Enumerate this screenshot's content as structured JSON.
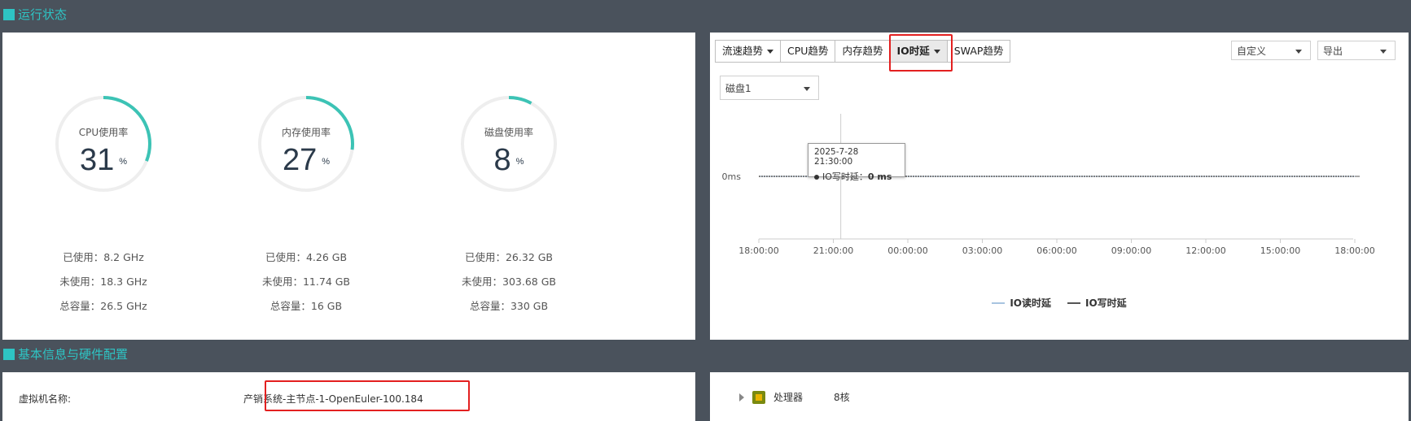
{
  "sections": {
    "status_title": "运行状态",
    "basic_title": "基本信息与硬件配置"
  },
  "gauges": [
    {
      "label": "CPU使用率",
      "value": "31",
      "unit": "%",
      "used": "已使用：8.2 GHz",
      "free": "未使用：18.3 GHz",
      "total": "总容量：26.5 GHz"
    },
    {
      "label": "内存使用率",
      "value": "27",
      "unit": "%",
      "used": "已使用：4.26 GB",
      "free": "未使用：11.74 GB",
      "total": "总容量：16 GB"
    },
    {
      "label": "磁盘使用率",
      "value": "8",
      "unit": "%",
      "used": "已使用：26.32 GB",
      "free": "未使用：303.68 GB",
      "total": "总容量：330 GB"
    }
  ],
  "tabs": {
    "flow": "流速趋势",
    "cpu": "CPU趋势",
    "mem": "内存趋势",
    "io": "IO时延",
    "swap": "SWAP趋势"
  },
  "controls": {
    "range": "自定义",
    "export": "导出",
    "disk": "磁盘1"
  },
  "tooltip": {
    "date": "2025-7-28 21:30:00",
    "series": "IO写时延：",
    "value": "0 ms"
  },
  "chart_data": {
    "type": "line",
    "x": [
      "18:00:00",
      "21:00:00",
      "00:00:00",
      "03:00:00",
      "06:00:00",
      "09:00:00",
      "12:00:00",
      "15:00:00",
      "18:00:00"
    ],
    "series": [
      {
        "name": "IO读时延",
        "values": [
          0,
          0,
          0,
          0,
          0,
          0,
          0,
          0,
          0
        ]
      },
      {
        "name": "IO写时延",
        "values": [
          0,
          0,
          0,
          0,
          0,
          0,
          0,
          0,
          0
        ]
      }
    ],
    "y_tick": "0ms",
    "ylim": [
      0,
      0
    ],
    "legend_position": "bottom",
    "colors": {
      "IO读时延": "#a8c4e0",
      "IO写时延": "#555555"
    }
  },
  "basic": {
    "vm_name_label": "虚拟机名称:",
    "vm_name_value": "产销系统-主节点-1-OpenEuler-100.184"
  },
  "hardware": {
    "cpu_label": "处理器",
    "cpu_value": "8核"
  },
  "colors": {
    "accent": "#2ec4c4",
    "highlight": "#e32020",
    "background": "#4a525c"
  }
}
